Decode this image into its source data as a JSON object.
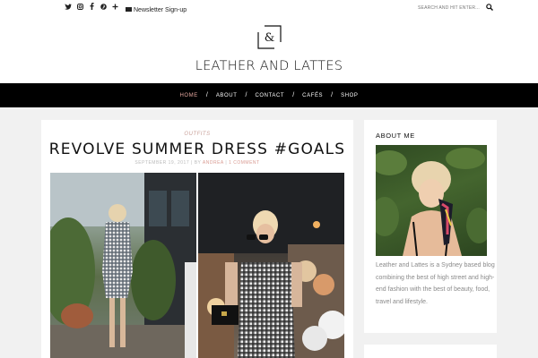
{
  "topbar": {
    "social_icons": [
      {
        "name": "twitter-icon",
        "glyph": "🐦"
      },
      {
        "name": "instagram-icon",
        "glyph": "◘"
      },
      {
        "name": "facebook-icon",
        "glyph": "f"
      },
      {
        "name": "pinterest-icon",
        "glyph": "℗"
      },
      {
        "name": "plus-icon",
        "glyph": "+"
      }
    ],
    "newsletter_label": "Newsletter Sign-up",
    "search_placeholder": "SEARCH AND HIT ENTER..."
  },
  "header": {
    "logo_text": "&",
    "site_title": "LEATHER AND LATTES"
  },
  "nav": {
    "items": [
      {
        "label": "HOME",
        "active": true
      },
      {
        "label": "ABOUT",
        "active": false
      },
      {
        "label": "CONTACT",
        "active": false
      },
      {
        "label": "CAFÉS",
        "active": false
      },
      {
        "label": "SHOP",
        "active": false
      }
    ],
    "separator": "/"
  },
  "post": {
    "category": "OUTFITS",
    "title": "REVOLVE SUMMER DRESS #GOALS",
    "date": "SEPTEMBER 19, 2017",
    "by": "BY",
    "author": "ANDREA",
    "comments": "1 COMMENT",
    "meta_sep": "|"
  },
  "sidebar": {
    "about_title": "ABOUT ME",
    "about_text": "Leather and Lattes is a Sydney based blog combining the best of high street and high-end fashion with the best of beauty, food, travel and lifestyle."
  },
  "colors": {
    "accent": "#e6a8a0",
    "nav_bg": "#000000",
    "page_bg": "#f1f1f1"
  }
}
